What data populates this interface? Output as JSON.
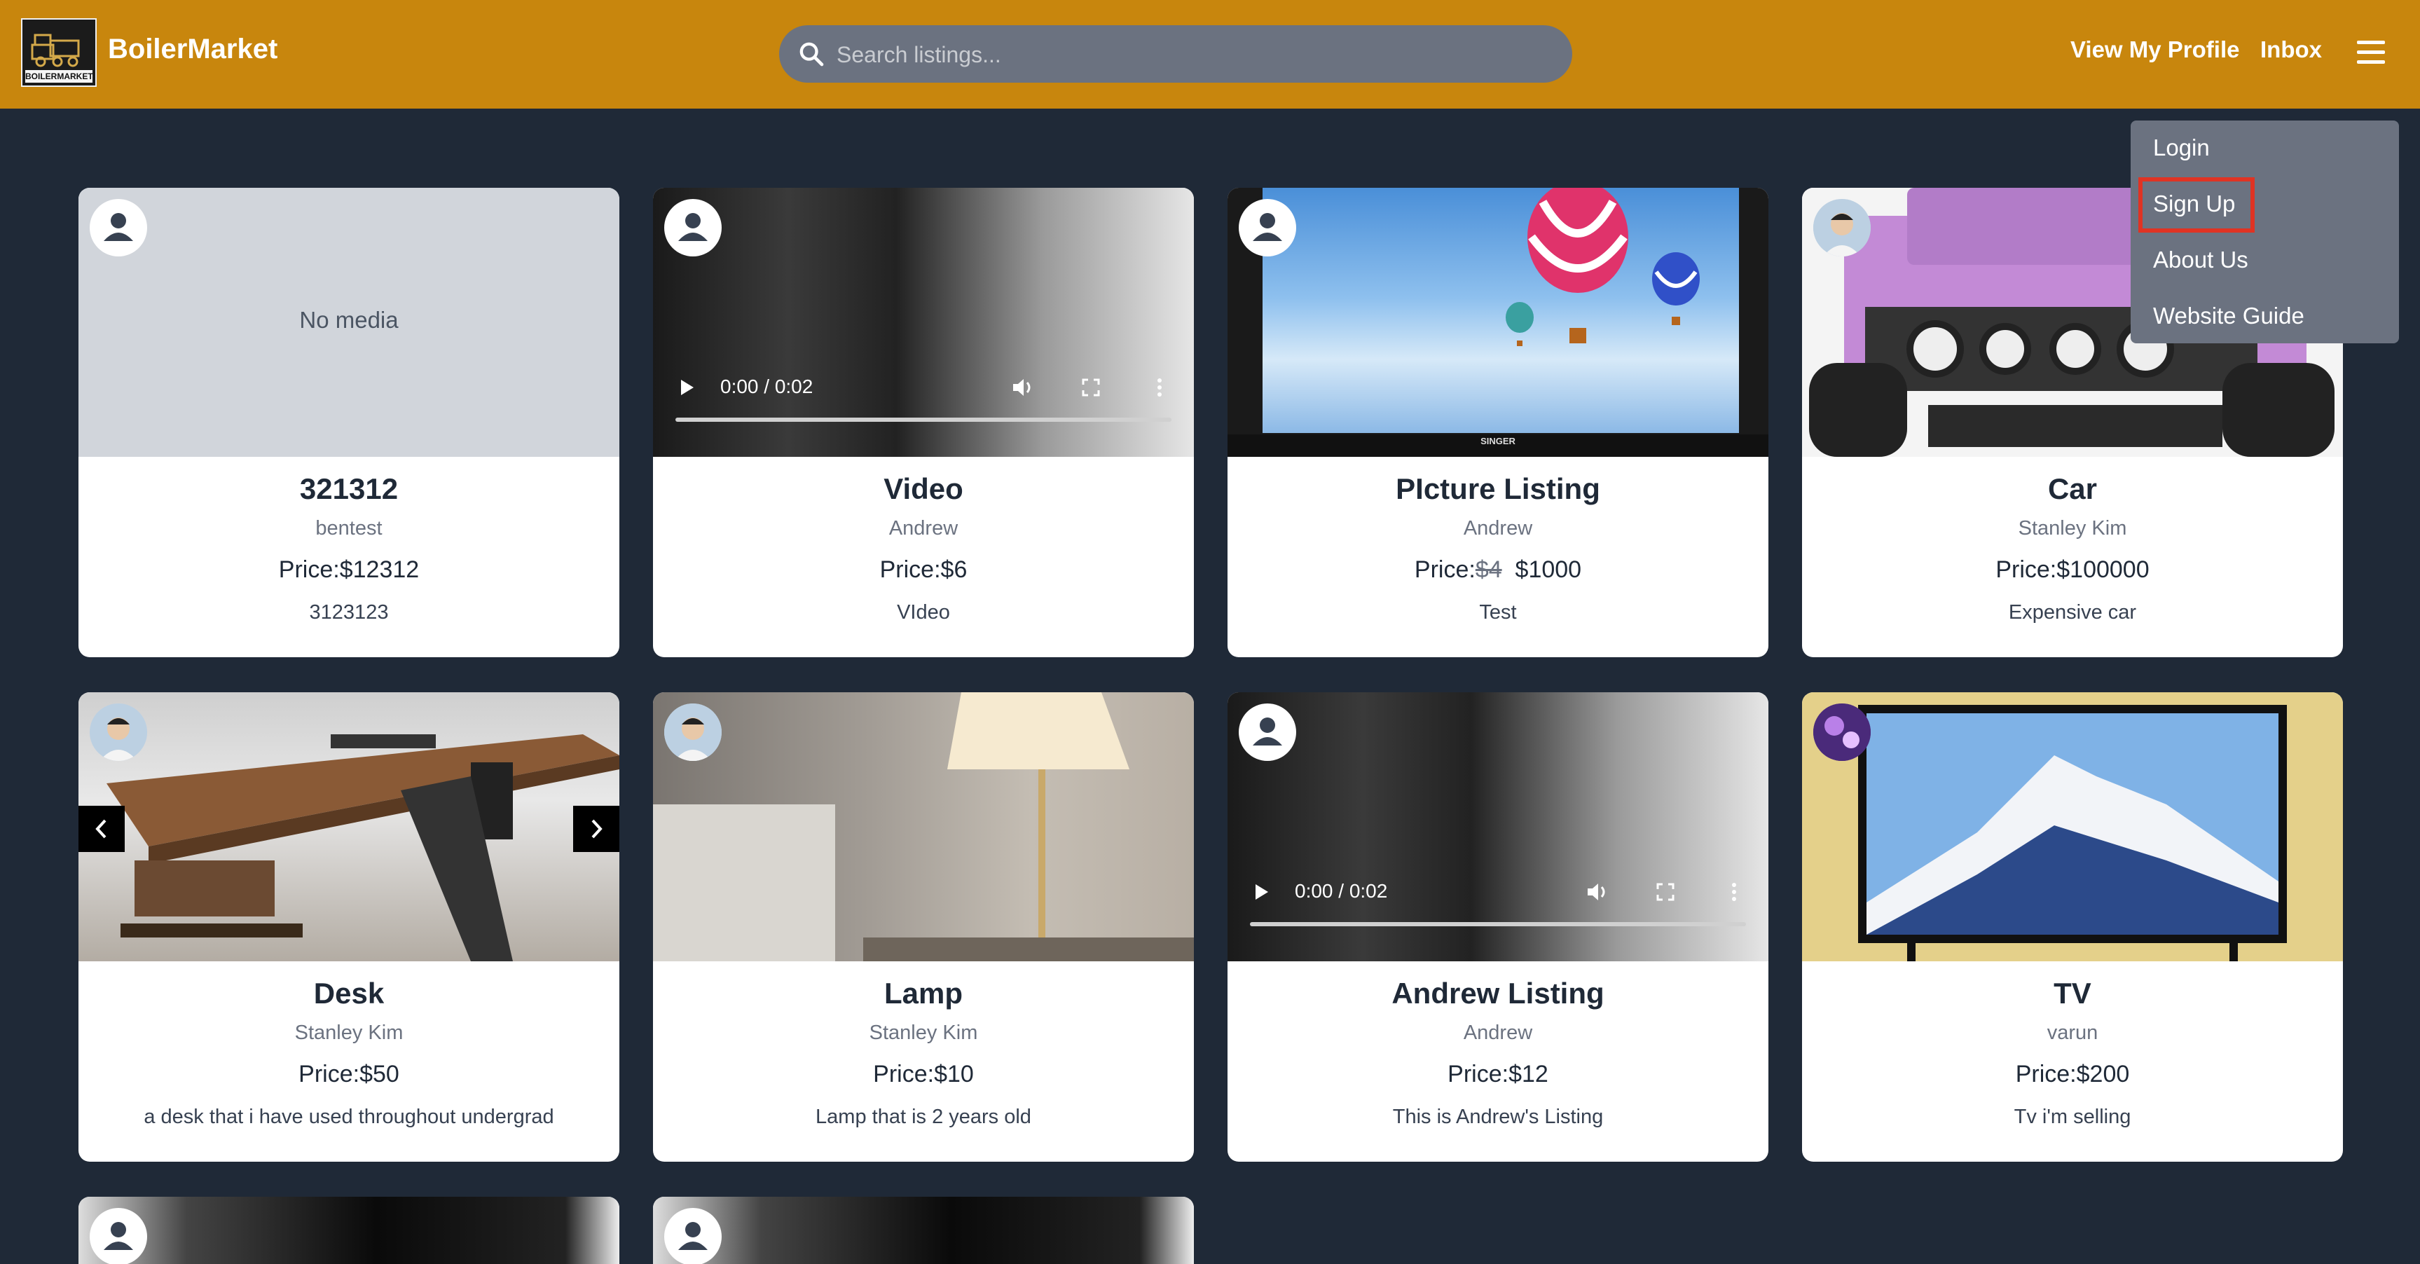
{
  "header": {
    "brand": "BoilerMarket",
    "logo_text": "BOILERMARKET",
    "search_placeholder": "Search listings...",
    "nav": {
      "profile": "View My Profile",
      "inbox": "Inbox"
    }
  },
  "dropdown": {
    "items": [
      {
        "label": "Login"
      },
      {
        "label": "Sign Up"
      },
      {
        "label": "About Us"
      },
      {
        "label": "Website Guide"
      }
    ],
    "highlighted": "Sign Up"
  },
  "listings": [
    {
      "title": "321312",
      "seller": "bentest",
      "price_label": "Price:",
      "price": "$12312",
      "description": "3123123",
      "media": "none",
      "media_text": "No media"
    },
    {
      "title": "Video",
      "seller": "Andrew",
      "price_label": "Price:",
      "price": "$6",
      "description": "VIdeo",
      "media": "video",
      "video_time": "0:00 / 0:02"
    },
    {
      "title": "PIcture Listing",
      "seller": "Andrew",
      "price_label": "Price:",
      "old_price": "$4",
      "price": "$1000",
      "description": "Test",
      "media": "tv-balloons",
      "tv_brand": "SINGER"
    },
    {
      "title": "Car",
      "seller": "Stanley Kim",
      "price_label": "Price:",
      "price": "$100000",
      "description": "Expensive car",
      "media": "car"
    },
    {
      "title": "Desk",
      "seller": "Stanley Kim",
      "price_label": "Price:",
      "price": "$50",
      "description": "a desk that i have used throughout undergrad",
      "media": "desk"
    },
    {
      "title": "Lamp",
      "seller": "Stanley Kim",
      "price_label": "Price:",
      "price": "$10",
      "description": "Lamp that is 2 years old",
      "media": "lamp"
    },
    {
      "title": "Andrew Listing",
      "seller": "Andrew",
      "price_label": "Price:",
      "price": "$12",
      "description": "This is Andrew's Listing",
      "media": "video",
      "video_time": "0:00 / 0:02"
    },
    {
      "title": "TV",
      "seller": "varun",
      "price_label": "Price:",
      "price": "$200",
      "description": "Tv i'm selling",
      "media": "tv-mountain"
    }
  ],
  "colors": {
    "header_bg": "#c8860d",
    "page_bg": "#1f2937",
    "dropdown_bg": "#6b7280",
    "highlight": "#e03323"
  }
}
